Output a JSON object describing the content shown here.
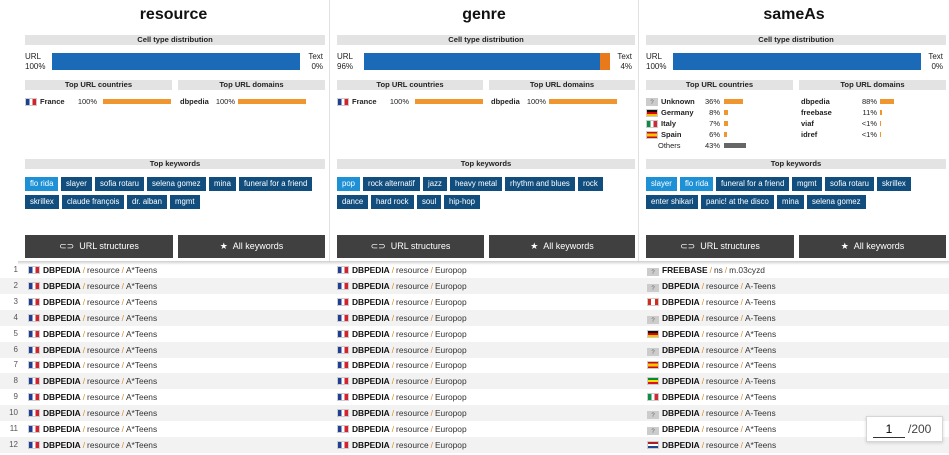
{
  "columns": [
    {
      "title": "resource",
      "dist_header": "Cell type distribution",
      "url_label": "URL",
      "url_pct": "100%",
      "url_value": 100,
      "text_label": "Text",
      "text_pct": "0%",
      "text_value": 0,
      "countries_header": "Top URL countries",
      "domains_header": "Top URL domains",
      "countries": [
        {
          "name": "France",
          "pct": "100%",
          "value": 100,
          "flag": "fr"
        }
      ],
      "domains": [
        {
          "name": "dbpedia",
          "pct": "100%",
          "value": 100
        }
      ],
      "keywords_header": "Top keywords",
      "keywords": [
        {
          "label": "flo rida",
          "style": "light"
        },
        {
          "label": "slayer"
        },
        {
          "label": "sofia rotaru"
        },
        {
          "label": "selena gomez"
        },
        {
          "label": "mina"
        },
        {
          "label": "funeral for a friend"
        },
        {
          "label": "skrillex"
        },
        {
          "label": "claude françois"
        },
        {
          "label": "dr. alban"
        },
        {
          "label": "mgmt"
        }
      ],
      "btn_url": "URL structures",
      "btn_kw": "All keywords"
    },
    {
      "title": "genre",
      "dist_header": "Cell type distribution",
      "url_label": "URL",
      "url_pct": "96%",
      "url_value": 96,
      "text_label": "Text",
      "text_pct": "4%",
      "text_value": 4,
      "countries_header": "Top URL countries",
      "domains_header": "Top URL domains",
      "countries": [
        {
          "name": "France",
          "pct": "100%",
          "value": 100,
          "flag": "fr"
        }
      ],
      "domains": [
        {
          "name": "dbpedia",
          "pct": "100%",
          "value": 100
        }
      ],
      "keywords_header": "Top keywords",
      "keywords": [
        {
          "label": "pop",
          "style": "light"
        },
        {
          "label": "rock alternatif"
        },
        {
          "label": "jazz"
        },
        {
          "label": "heavy metal"
        },
        {
          "label": "rhythm and blues"
        },
        {
          "label": "rock"
        },
        {
          "label": "dance"
        },
        {
          "label": "hard rock"
        },
        {
          "label": "soul"
        },
        {
          "label": "hip-hop"
        }
      ],
      "btn_url": "URL structures",
      "btn_kw": "All keywords"
    },
    {
      "title": "sameAs",
      "dist_header": "Cell type distribution",
      "url_label": "URL",
      "url_pct": "100%",
      "url_value": 100,
      "text_label": "Text",
      "text_pct": "0%",
      "text_value": 0,
      "countries_header": "Top URL countries",
      "domains_header": "Top URL domains",
      "countries": [
        {
          "name": "Unknown",
          "pct": "36%",
          "value": 36,
          "flag": "un"
        },
        {
          "name": "Germany",
          "pct": "8%",
          "value": 8,
          "flag": "de"
        },
        {
          "name": "Italy",
          "pct": "7%",
          "value": 7,
          "flag": "it"
        },
        {
          "name": "Spain",
          "pct": "6%",
          "value": 6,
          "flag": "es"
        },
        {
          "name": "Others",
          "pct": "43%",
          "value": 43,
          "flag": ""
        }
      ],
      "domains": [
        {
          "name": "dbpedia",
          "pct": "88%",
          "value": 88
        },
        {
          "name": "freebase",
          "pct": "11%",
          "value": 11
        },
        {
          "name": "viaf",
          "pct": "<1%",
          "value": 1
        },
        {
          "name": "idref",
          "pct": "<1%",
          "value": 0.5
        }
      ],
      "keywords_header": "Top keywords",
      "keywords": [
        {
          "label": "slayer",
          "style": "light"
        },
        {
          "label": "flo rida",
          "style": "light"
        },
        {
          "label": "funeral for a friend"
        },
        {
          "label": "mgmt"
        },
        {
          "label": "sofia rotaru"
        },
        {
          "label": "skrillex"
        },
        {
          "label": "enter shikari"
        },
        {
          "label": "panic! at the disco"
        },
        {
          "label": "mina"
        },
        {
          "label": "selena gomez"
        }
      ],
      "btn_url": "URL structures",
      "btn_kw": "All keywords"
    }
  ],
  "rows": [
    {
      "n": "1",
      "c": [
        {
          "flag": "fr",
          "dom": "DBPEDIA",
          "a": "resource",
          "b": "A*Teens"
        },
        {
          "flag": "fr",
          "dom": "DBPEDIA",
          "a": "resource",
          "b": "Europop"
        },
        {
          "flag": "un",
          "dom": "FREEBASE",
          "a": "ns",
          "b": "m.03cyzd"
        }
      ]
    },
    {
      "n": "2",
      "c": [
        {
          "flag": "fr",
          "dom": "DBPEDIA",
          "a": "resource",
          "b": "A*Teens"
        },
        {
          "flag": "fr",
          "dom": "DBPEDIA",
          "a": "resource",
          "b": "Europop"
        },
        {
          "flag": "un",
          "dom": "DBPEDIA",
          "a": "resource",
          "b": "A-Teens"
        }
      ]
    },
    {
      "n": "3",
      "c": [
        {
          "flag": "fr",
          "dom": "DBPEDIA",
          "a": "resource",
          "b": "A*Teens"
        },
        {
          "flag": "fr",
          "dom": "DBPEDIA",
          "a": "resource",
          "b": "Europop"
        },
        {
          "flag": "ca",
          "dom": "DBPEDIA",
          "a": "resource",
          "b": "A-Teens"
        }
      ]
    },
    {
      "n": "4",
      "c": [
        {
          "flag": "fr",
          "dom": "DBPEDIA",
          "a": "resource",
          "b": "A*Teens"
        },
        {
          "flag": "fr",
          "dom": "DBPEDIA",
          "a": "resource",
          "b": "Europop"
        },
        {
          "flag": "un",
          "dom": "DBPEDIA",
          "a": "resource",
          "b": "A-Teens"
        }
      ]
    },
    {
      "n": "5",
      "c": [
        {
          "flag": "fr",
          "dom": "DBPEDIA",
          "a": "resource",
          "b": "A*Teens"
        },
        {
          "flag": "fr",
          "dom": "DBPEDIA",
          "a": "resource",
          "b": "Europop"
        },
        {
          "flag": "de",
          "dom": "DBPEDIA",
          "a": "resource",
          "b": "A*Teens"
        }
      ]
    },
    {
      "n": "6",
      "c": [
        {
          "flag": "fr",
          "dom": "DBPEDIA",
          "a": "resource",
          "b": "A*Teens"
        },
        {
          "flag": "fr",
          "dom": "DBPEDIA",
          "a": "resource",
          "b": "Europop"
        },
        {
          "flag": "un",
          "dom": "DBPEDIA",
          "a": "resource",
          "b": "A*Teens"
        }
      ]
    },
    {
      "n": "7",
      "c": [
        {
          "flag": "fr",
          "dom": "DBPEDIA",
          "a": "resource",
          "b": "A*Teens"
        },
        {
          "flag": "fr",
          "dom": "DBPEDIA",
          "a": "resource",
          "b": "Europop"
        },
        {
          "flag": "es",
          "dom": "DBPEDIA",
          "a": "resource",
          "b": "A*Teens"
        }
      ]
    },
    {
      "n": "8",
      "c": [
        {
          "flag": "fr",
          "dom": "DBPEDIA",
          "a": "resource",
          "b": "A*Teens"
        },
        {
          "flag": "fr",
          "dom": "DBPEDIA",
          "a": "resource",
          "b": "Europop"
        },
        {
          "flag": "et",
          "dom": "DBPEDIA",
          "a": "resource",
          "b": "A-Teens"
        }
      ]
    },
    {
      "n": "9",
      "c": [
        {
          "flag": "fr",
          "dom": "DBPEDIA",
          "a": "resource",
          "b": "A*Teens"
        },
        {
          "flag": "fr",
          "dom": "DBPEDIA",
          "a": "resource",
          "b": "Europop"
        },
        {
          "flag": "it",
          "dom": "DBPEDIA",
          "a": "resource",
          "b": "A*Teens"
        }
      ]
    },
    {
      "n": "10",
      "c": [
        {
          "flag": "fr",
          "dom": "DBPEDIA",
          "a": "resource",
          "b": "A*Teens"
        },
        {
          "flag": "fr",
          "dom": "DBPEDIA",
          "a": "resource",
          "b": "Europop"
        },
        {
          "flag": "un",
          "dom": "DBPEDIA",
          "a": "resource",
          "b": "A-Teens"
        }
      ]
    },
    {
      "n": "11",
      "c": [
        {
          "flag": "fr",
          "dom": "DBPEDIA",
          "a": "resource",
          "b": "A*Teens"
        },
        {
          "flag": "fr",
          "dom": "DBPEDIA",
          "a": "resource",
          "b": "Europop"
        },
        {
          "flag": "un",
          "dom": "DBPEDIA",
          "a": "resource",
          "b": "A*Teens"
        }
      ]
    },
    {
      "n": "12",
      "c": [
        {
          "flag": "fr",
          "dom": "DBPEDIA",
          "a": "resource",
          "b": "A*Teens"
        },
        {
          "flag": "fr",
          "dom": "DBPEDIA",
          "a": "resource",
          "b": "Europop"
        },
        {
          "flag": "nl",
          "dom": "DBPEDIA",
          "a": "resource",
          "b": "A*Teens"
        }
      ]
    }
  ],
  "pager": {
    "page": "1",
    "total": "/200"
  },
  "colors": {
    "url_bar": "#1b6ab8",
    "text_bar": "#e87a1b",
    "country_bar": "#f0962e",
    "keyword_dark": "#114e7e",
    "keyword_light": "#1e90d6",
    "button": "#404040",
    "path_separator": "#e08a2a"
  },
  "icons": {
    "url_structures": "link-icon",
    "all_keywords": "star-icon"
  }
}
